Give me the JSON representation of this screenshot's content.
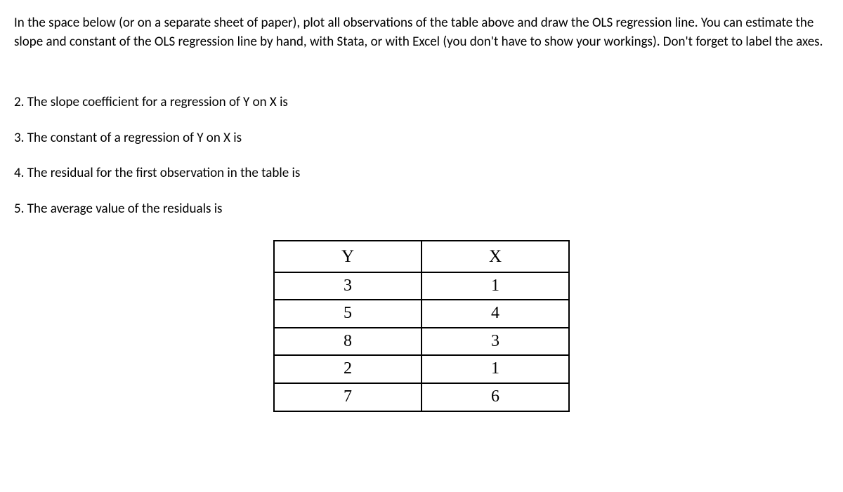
{
  "intro": "In the space below (or on a separate sheet of paper), plot all observations of the table above and draw the OLS regression line. You can estimate the slope and constant of the OLS regression line by hand, with Stata, or with Excel (you don't have to show your workings). Don't forget to label the axes.",
  "questions": {
    "q2": "2. The slope coefficient for a regression of Y on X is",
    "q3": "3. The constant of a regression of Y on X is",
    "q4": "4. The residual for the first observation in the table is",
    "q5": "5. The average value of the residuals is"
  },
  "table": {
    "header_y": "Y",
    "header_x": "X",
    "rows": [
      {
        "y": "3",
        "x": "1"
      },
      {
        "y": "5",
        "x": "4"
      },
      {
        "y": "8",
        "x": "3"
      },
      {
        "y": "2",
        "x": "1"
      },
      {
        "y": "7",
        "x": "6"
      }
    ]
  }
}
